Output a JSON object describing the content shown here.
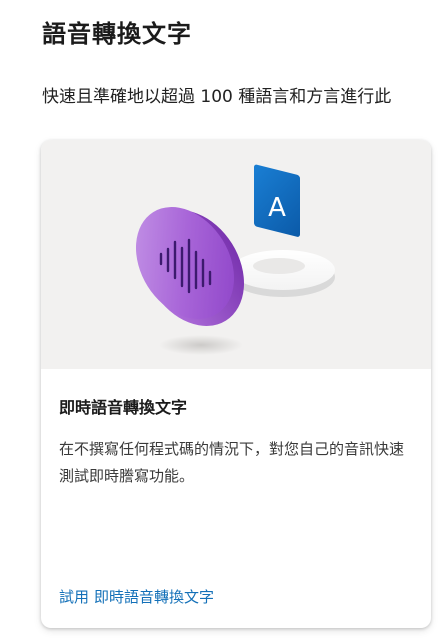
{
  "page": {
    "title": "語音轉換文字",
    "subtitle": "快速且準確地以超過 100 種語言和方言進行此"
  },
  "card": {
    "hero_icon": "speech-to-text-illustration",
    "hero_badge_letter": "A",
    "title": "即時語音轉換文字",
    "description": "在不撰寫任何程式碼的情況下，對您自己的音訊快速測試即時謄寫功能。",
    "link_prefix": "試用",
    "link_label": "即時語音轉換文字"
  },
  "colors": {
    "link": "#1370b8",
    "hero_background": "#f2f1f0",
    "badge_blue": "#0f6cbd",
    "disc_purple": "#9b4fd0"
  }
}
